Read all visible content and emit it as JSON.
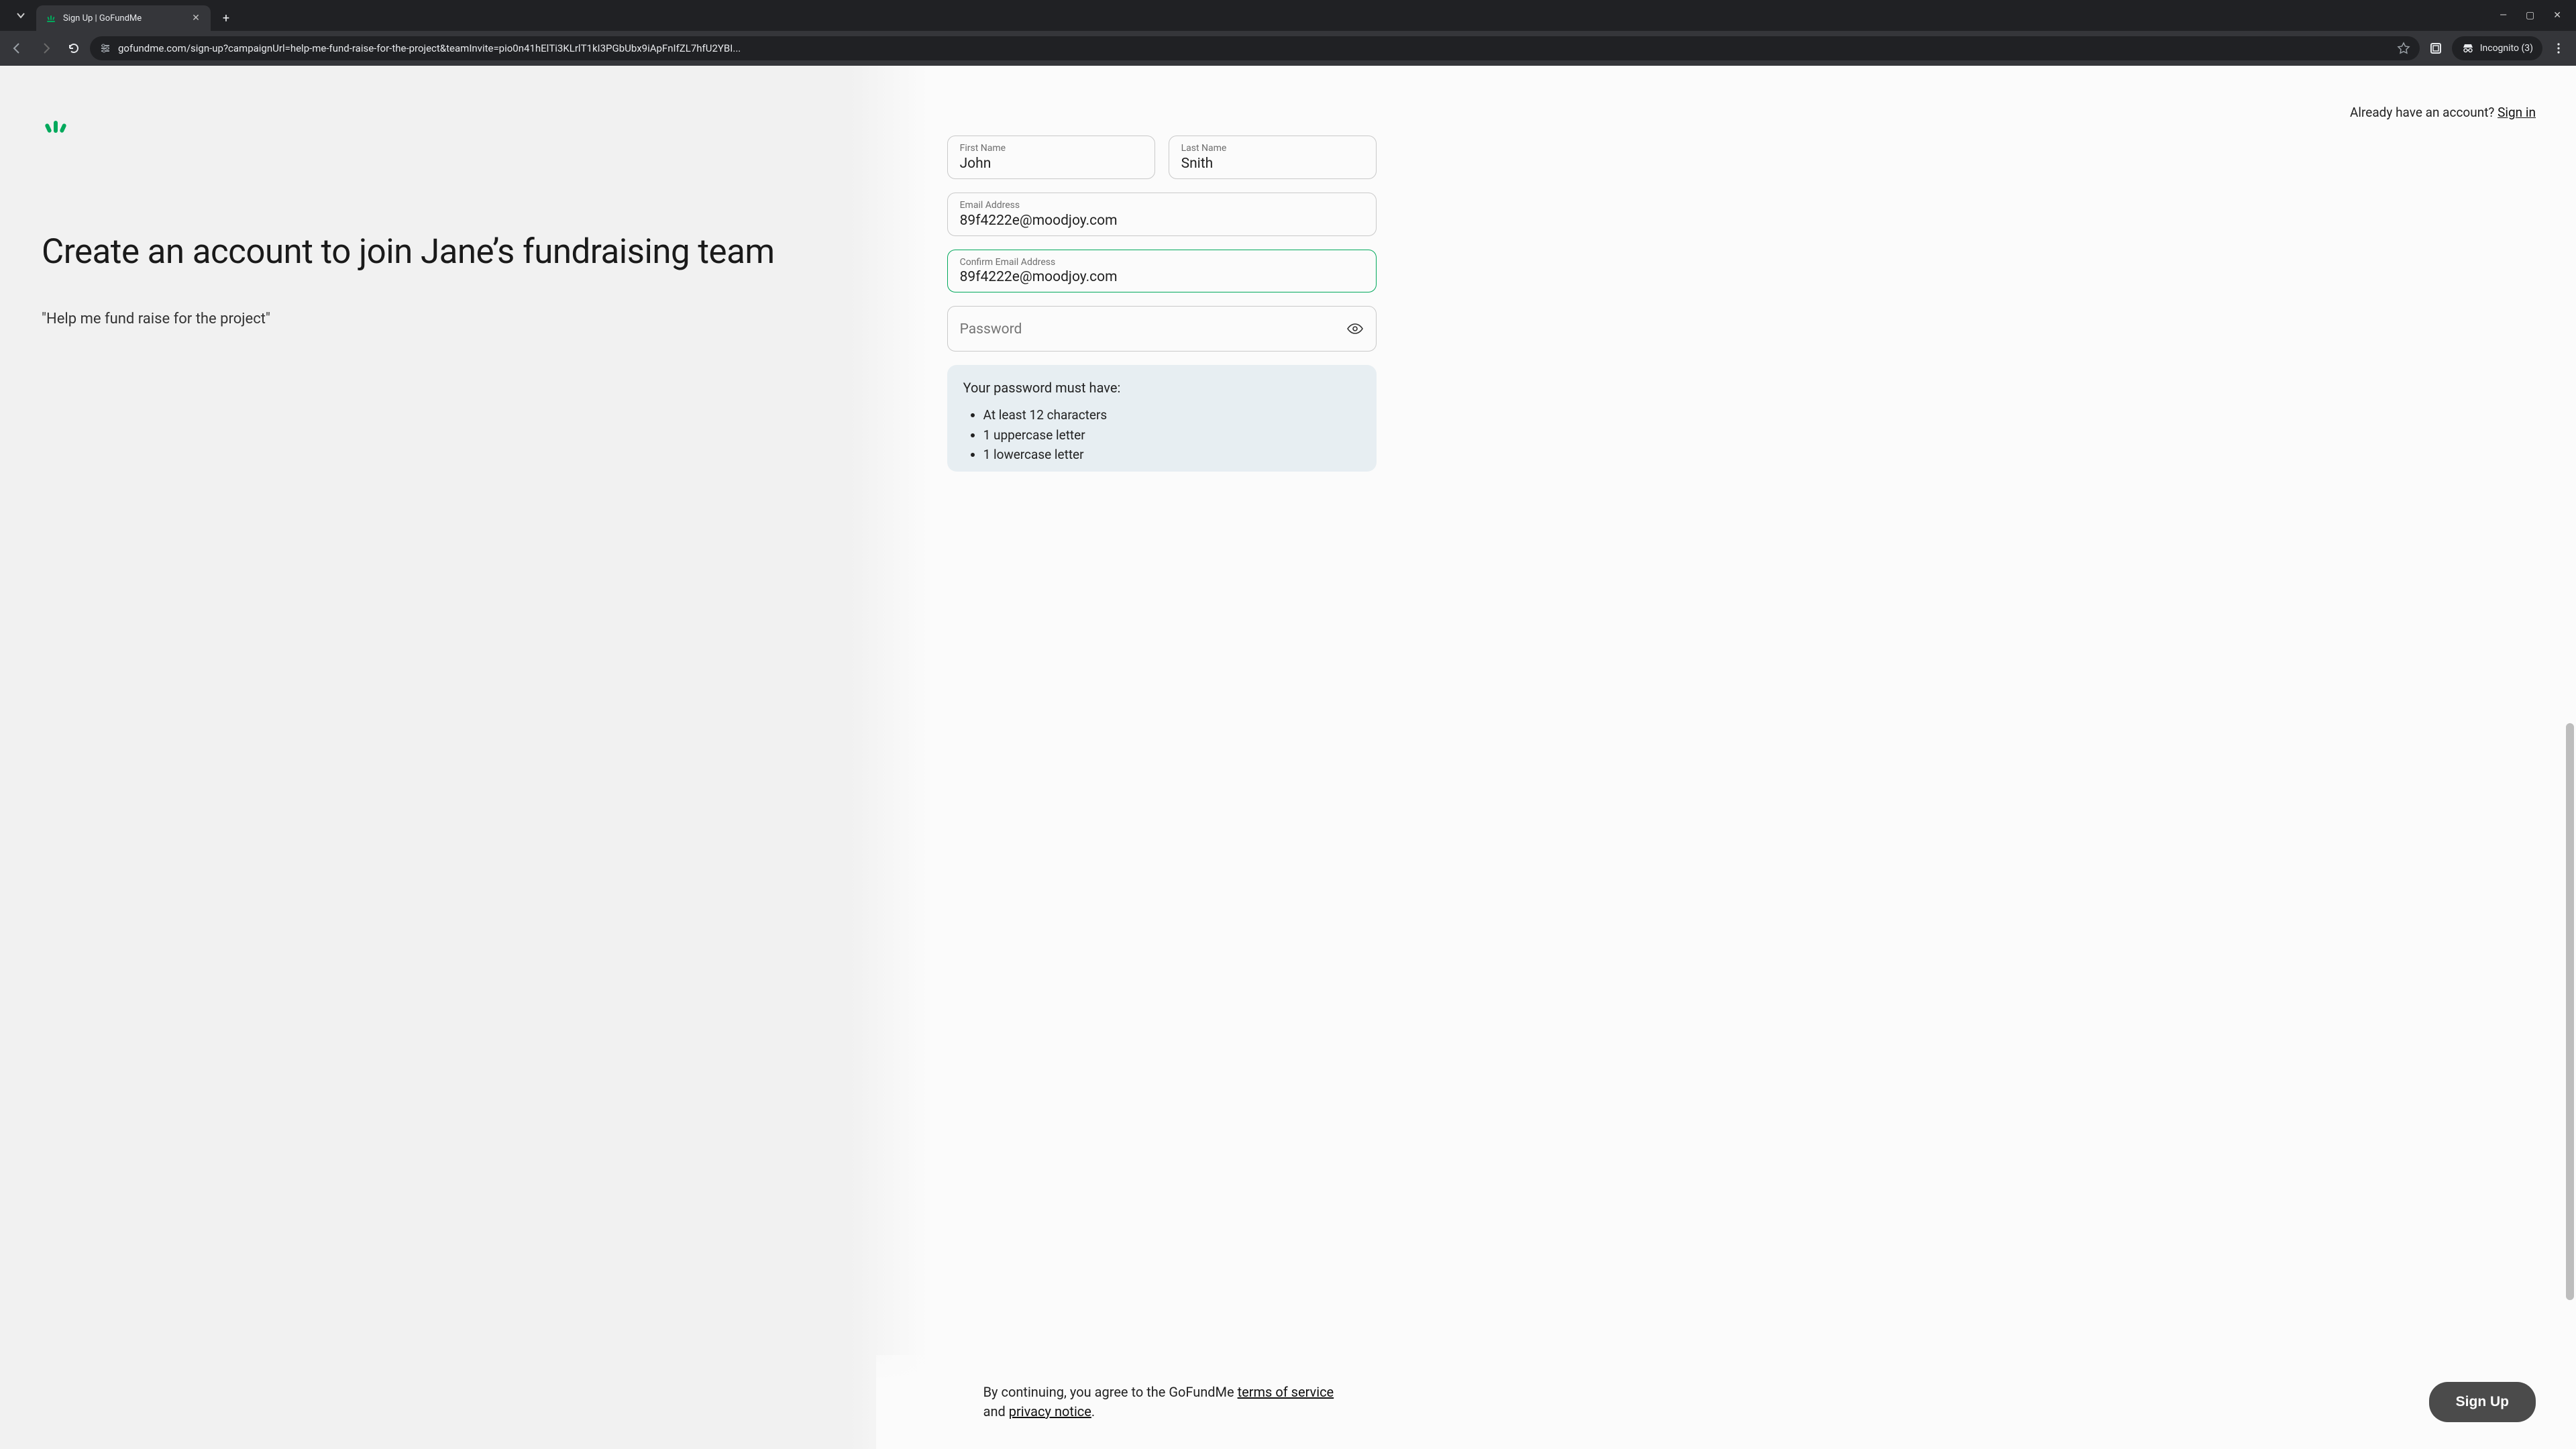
{
  "browser": {
    "tab_title": "Sign Up | GoFundMe",
    "url": "gofundme.com/sign-up?campaignUrl=help-me-fund-raise-for-the-project&teamInvite=pio0n41hElTi3KLrlT1kI3PGbUbx9iApFnIfZL7hfU2YBI...",
    "incognito_label": "Incognito (3)"
  },
  "header": {
    "already_text": "Already have an account? ",
    "signin_label": "Sign in"
  },
  "left": {
    "headline": "Create an account to join Jane’s fundraising team",
    "subquote": "\"Help me fund raise for the project\""
  },
  "form": {
    "first_name": {
      "label": "First Name",
      "value": "John"
    },
    "last_name": {
      "label": "Last Name",
      "value": "Snith"
    },
    "email": {
      "label": "Email Address",
      "value": "89f4222e@moodjoy.com"
    },
    "confirm": {
      "label": "Confirm Email Address",
      "value": "89f4222e@moodjoy.com"
    },
    "password": {
      "label": "Password",
      "value": ""
    },
    "hints_title": "Your password must have:",
    "hints": [
      "At least 12 characters",
      "1 uppercase letter",
      "1 lowercase letter"
    ]
  },
  "footer": {
    "agree_pre": "By continuing, you agree to the GoFundMe ",
    "tos": "terms of service",
    "agree_mid": " and ",
    "privacy": "privacy notice",
    "agree_post": ".",
    "signup_label": "Sign Up"
  }
}
